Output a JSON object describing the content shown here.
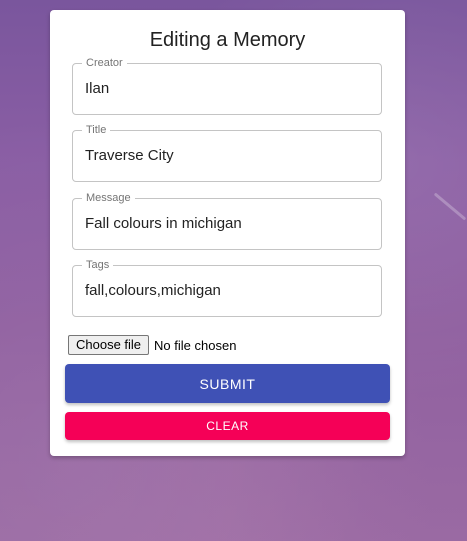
{
  "form": {
    "title": "Editing a Memory",
    "fields": [
      {
        "label": "Creator",
        "value": "Ilan"
      },
      {
        "label": "Title",
        "value": "Traverse City"
      },
      {
        "label": "Message",
        "value": "Fall colours in michigan"
      },
      {
        "label": "Tags",
        "value": "fall,colours,michigan"
      }
    ],
    "file": {
      "button_label": "Choose file",
      "status": "No file chosen"
    },
    "submit_label": "Submit",
    "clear_label": "Clear"
  },
  "colors": {
    "submit": "#3f51b5",
    "clear": "#f50057",
    "background": "#8a5ea4"
  }
}
